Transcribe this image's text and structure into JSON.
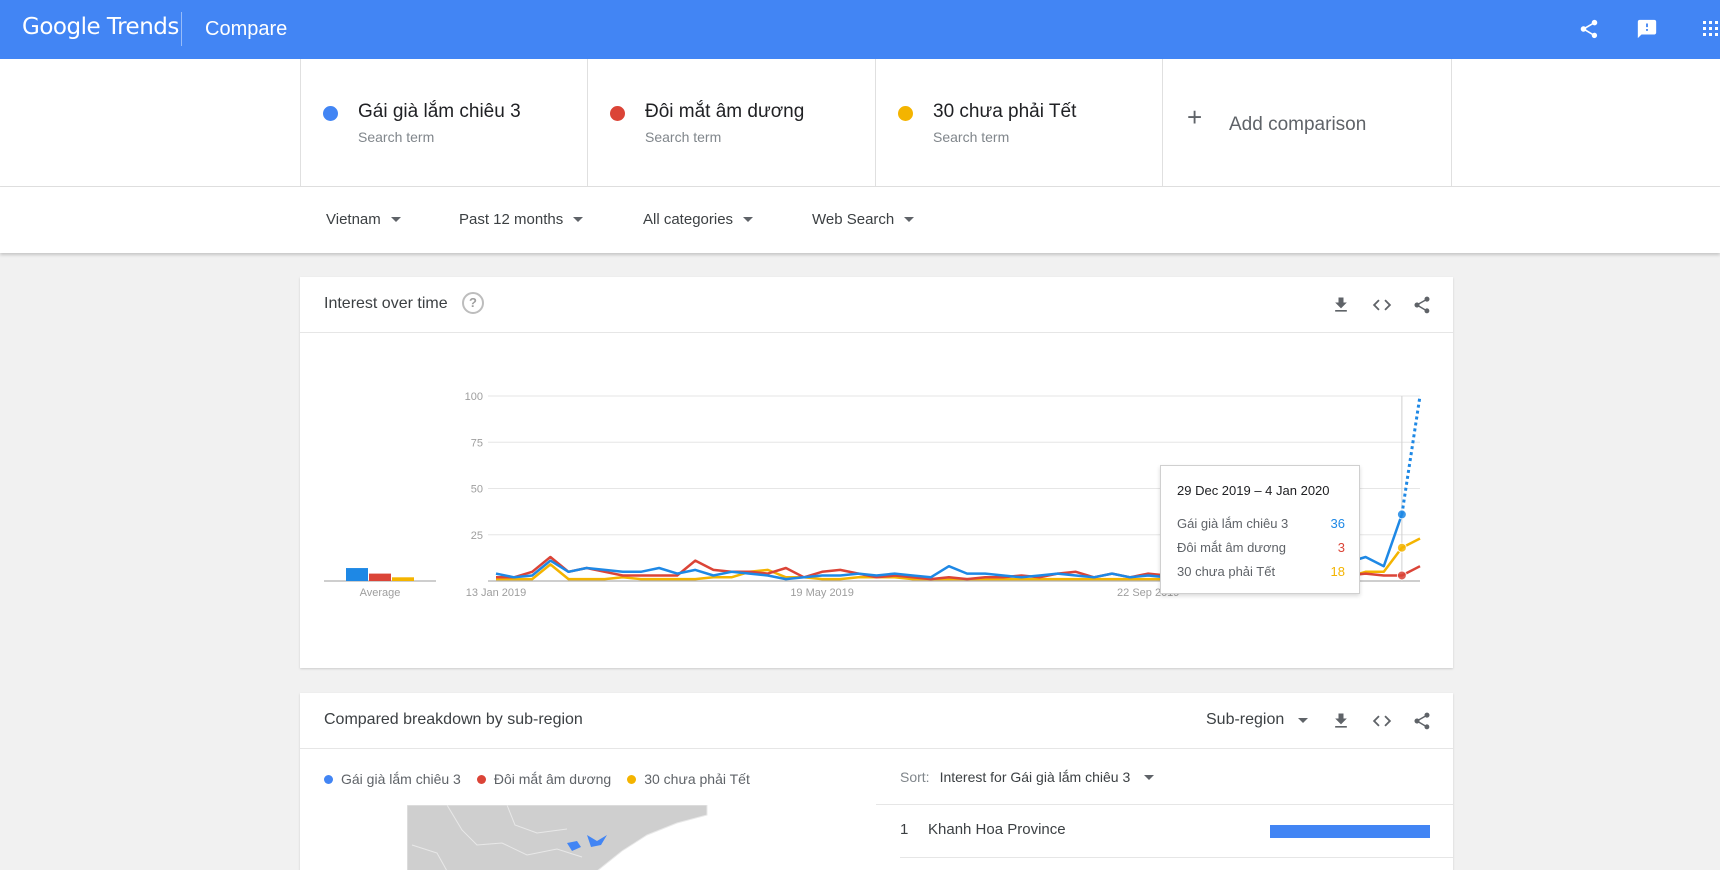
{
  "app": {
    "logo_google": "Google",
    "logo_trends": "Trends",
    "page_title": "Compare"
  },
  "terms": [
    {
      "name": "Gái già lắm chiêu 3",
      "sub": "Search term",
      "color": "#4285f4"
    },
    {
      "name": "Đôi mắt âm dương",
      "sub": "Search term",
      "color": "#db4437"
    },
    {
      "name": "30 chưa phải Tết",
      "sub": "Search term",
      "color": "#f4b400"
    }
  ],
  "add_comparison": "Add comparison",
  "filters": {
    "region": "Vietnam",
    "time": "Past 12 months",
    "category": "All categories",
    "search_type": "Web Search"
  },
  "interest_card": {
    "title": "Interest over time",
    "help": "?"
  },
  "chart_data": {
    "type": "line",
    "title": "Interest over time",
    "ylim": [
      0,
      100
    ],
    "y_ticks": [
      "100",
      "75",
      "50",
      "25"
    ],
    "x_tick_labels": [
      "13 Jan 2019",
      "19 May 2019",
      "22 Sep 2019"
    ],
    "x": [
      "13 Jan 2019",
      "20 Jan 2019",
      "27 Jan 2019",
      "3 Feb 2019",
      "10 Feb 2019",
      "17 Feb 2019",
      "24 Feb 2019",
      "3 Mar 2019",
      "10 Mar 2019",
      "17 Mar 2019",
      "24 Mar 2019",
      "31 Mar 2019",
      "7 Apr 2019",
      "14 Apr 2019",
      "21 Apr 2019",
      "28 Apr 2019",
      "5 May 2019",
      "12 May 2019",
      "19 May 2019",
      "26 May 2019",
      "2 Jun 2019",
      "9 Jun 2019",
      "16 Jun 2019",
      "23 Jun 2019",
      "30 Jun 2019",
      "7 Jul 2019",
      "14 Jul 2019",
      "21 Jul 2019",
      "28 Jul 2019",
      "4 Aug 2019",
      "11 Aug 2019",
      "18 Aug 2019",
      "25 Aug 2019",
      "1 Sep 2019",
      "8 Sep 2019",
      "15 Sep 2019",
      "22 Sep 2019",
      "29 Sep 2019",
      "6 Oct 2019",
      "13 Oct 2019",
      "20 Oct 2019",
      "27 Oct 2019",
      "3 Nov 2019",
      "10 Nov 2019",
      "17 Nov 2019",
      "24 Nov 2019",
      "1 Dec 2019",
      "8 Dec 2019",
      "15 Dec 2019",
      "22 Dec 2019",
      "29 Dec 2019",
      "5 Jan 2020"
    ],
    "series": [
      {
        "name": "Gái già lắm chiêu 3",
        "color": "#1e88e5",
        "average": 7,
        "values": [
          4,
          2,
          3,
          11,
          5,
          7,
          6,
          5,
          5,
          7,
          4,
          6,
          3,
          5,
          4,
          3,
          1,
          2,
          3,
          3,
          4,
          3,
          4,
          3,
          2,
          8,
          4,
          4,
          3,
          2,
          3,
          4,
          3,
          2,
          4,
          2,
          3,
          2,
          3,
          2,
          2,
          2,
          2,
          3,
          3,
          4,
          6,
          10,
          13,
          8,
          36,
          null
        ],
        "projected_last": 100
      },
      {
        "name": "Đôi mắt âm dương",
        "color": "#db4437",
        "average": 4,
        "values": [
          2,
          2,
          5,
          13,
          5,
          7,
          5,
          3,
          3,
          3,
          3,
          11,
          6,
          5,
          5,
          4,
          7,
          2,
          5,
          6,
          4,
          2,
          3,
          2,
          1,
          2,
          1,
          2,
          2,
          3,
          2,
          4,
          5,
          2,
          4,
          2,
          4,
          3,
          4,
          4,
          6,
          4,
          3,
          2,
          3,
          3,
          4,
          3,
          4,
          3,
          3,
          8
        ],
        "projected_last": null
      },
      {
        "name": "30 chưa phải Tết",
        "color": "#f4b400",
        "average": 2,
        "values": [
          1,
          1,
          1,
          9,
          1,
          1,
          1,
          2,
          1,
          1,
          1,
          1,
          2,
          2,
          5,
          6,
          2,
          2,
          1,
          1,
          2,
          2,
          2,
          1,
          1,
          1,
          1,
          1,
          1,
          1,
          1,
          1,
          1,
          1,
          1,
          1,
          1,
          1,
          1,
          1,
          2,
          2,
          1,
          1,
          2,
          4,
          3,
          2,
          5,
          5,
          18,
          23
        ],
        "projected_last": null
      }
    ],
    "average_label": "Average",
    "tooltip": {
      "date": "29 Dec 2019 – 4 Jan 2020",
      "index": 50,
      "values": [
        "36",
        "3",
        "18"
      ]
    }
  },
  "subregion_card": {
    "title": "Compared breakdown by sub-region",
    "dropdown": "Sub-region",
    "sort_label": "Sort:",
    "sort_value": "Interest for Gái già lắm chiêu 3",
    "rows": [
      {
        "rank": "1",
        "name": "Khanh Hoa Province"
      }
    ]
  }
}
